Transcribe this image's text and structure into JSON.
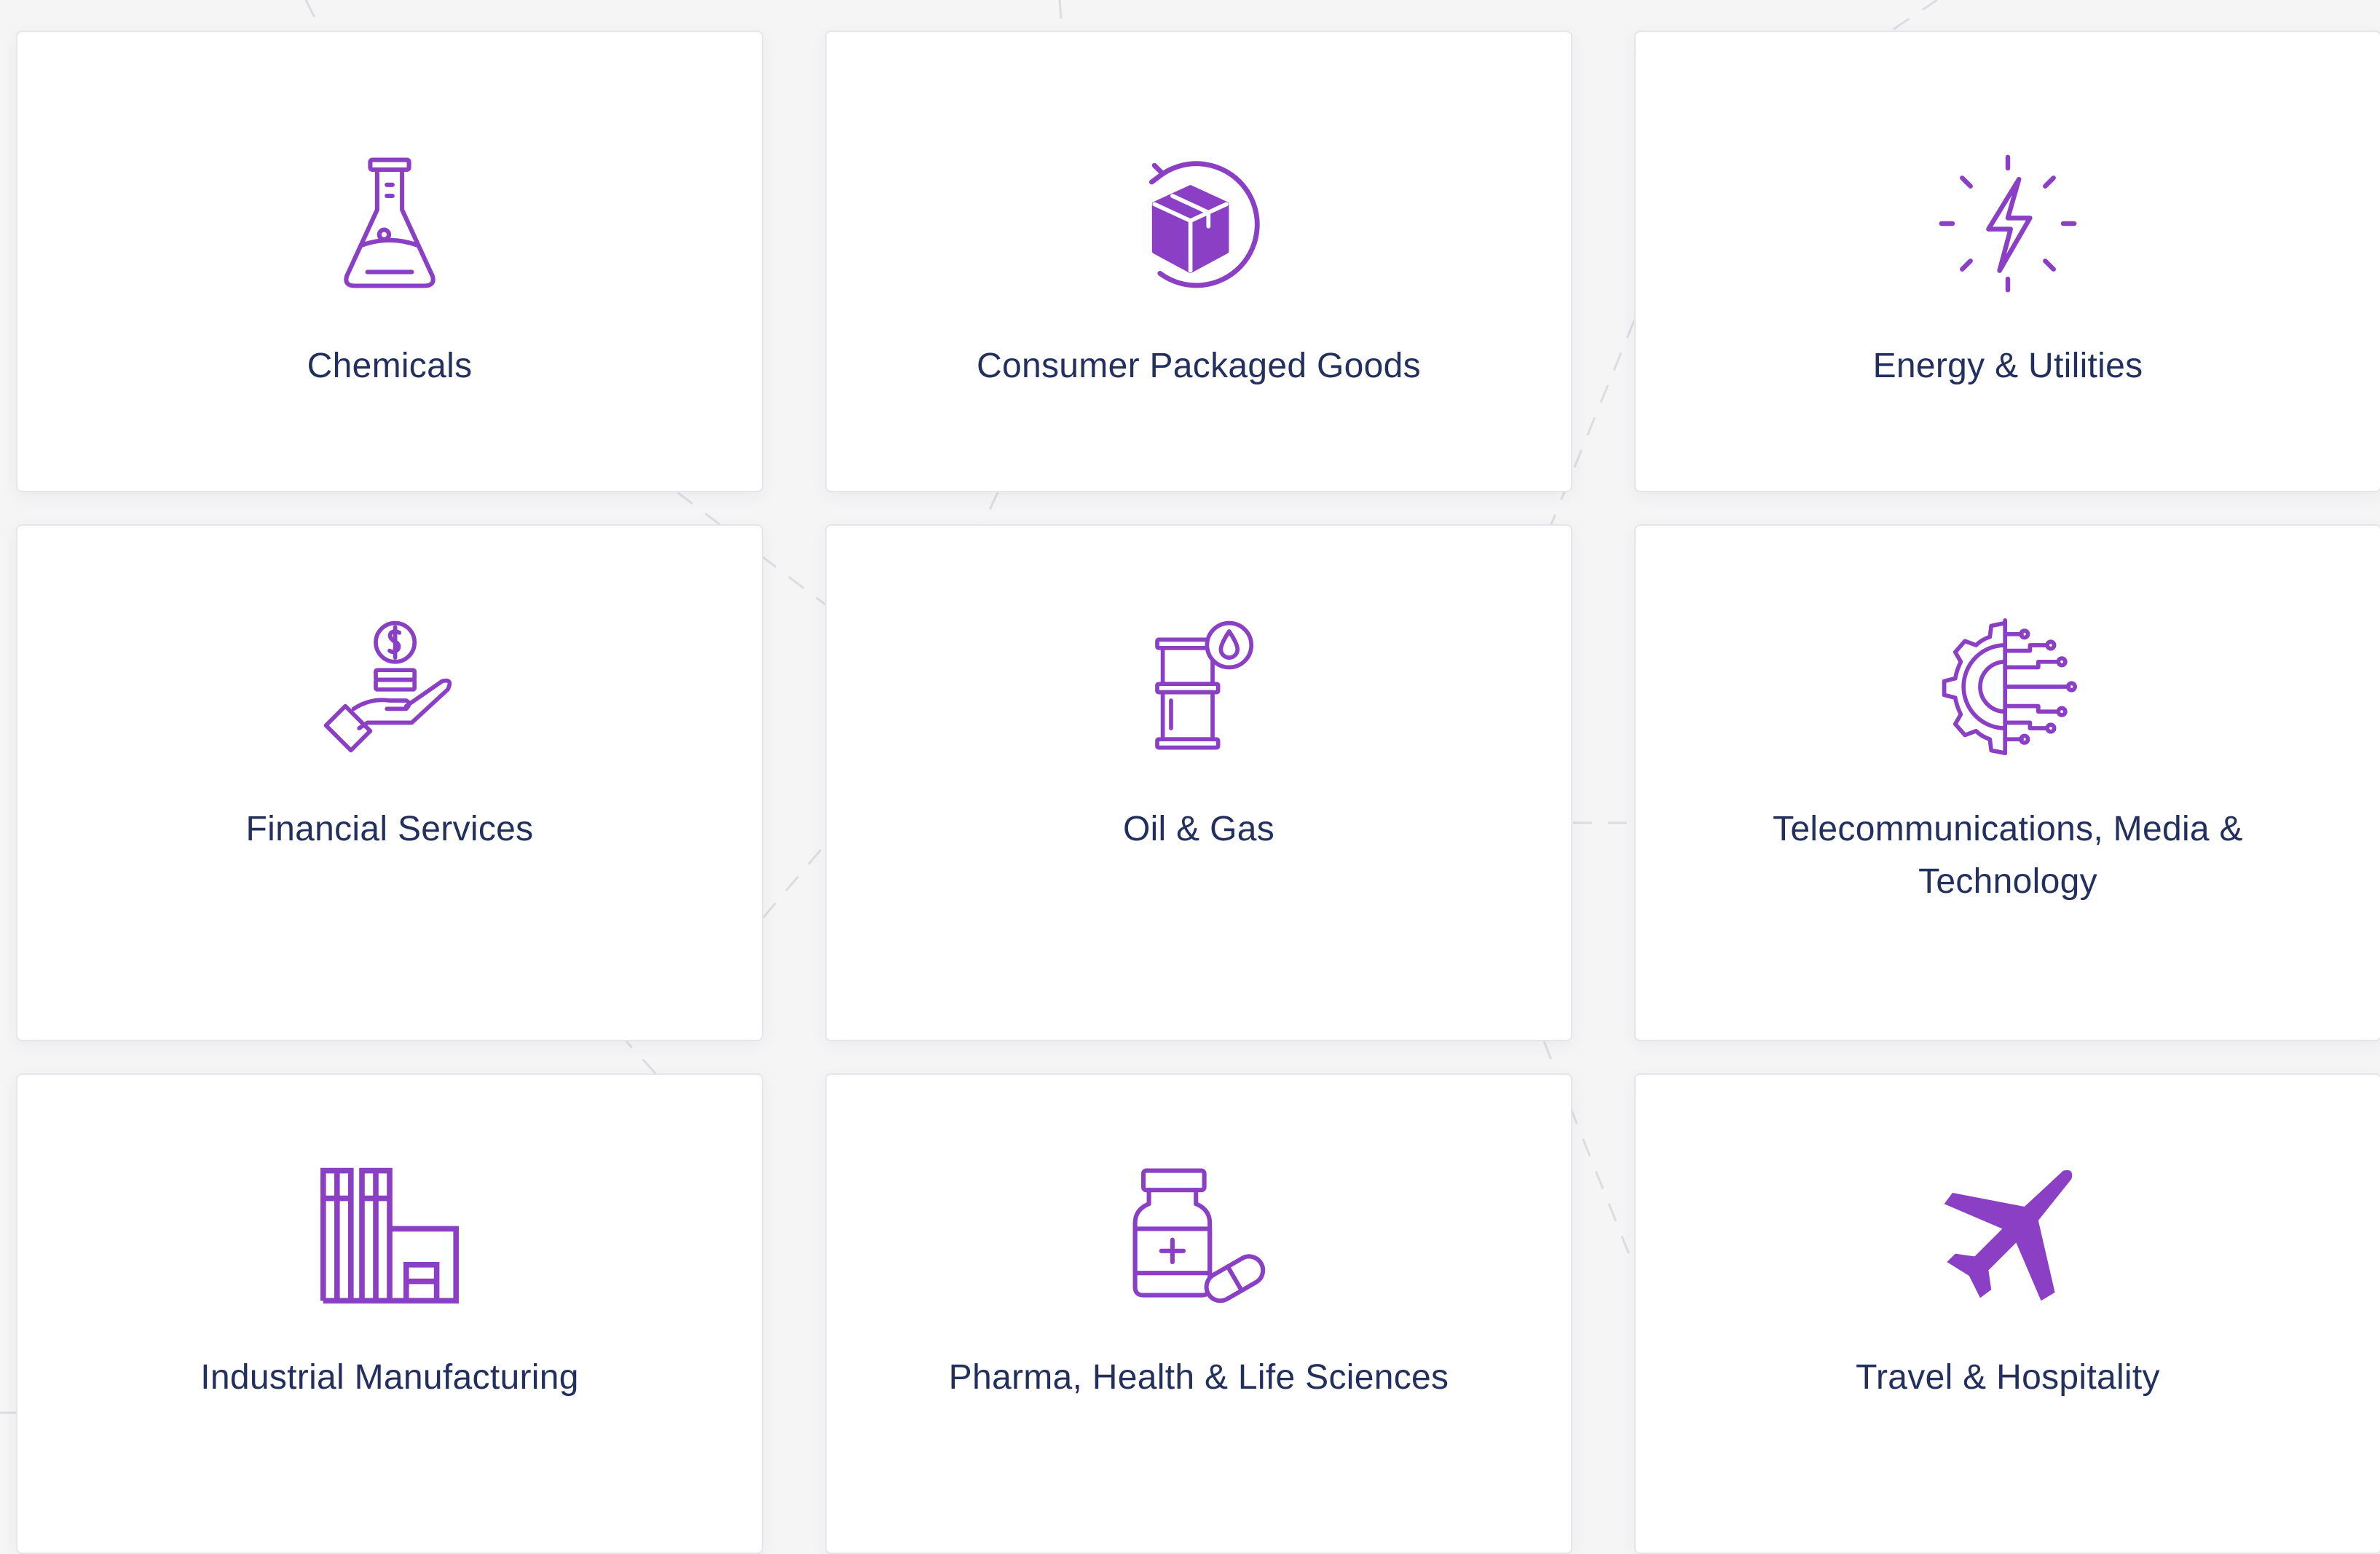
{
  "colors": {
    "accent": "#8b3fc4",
    "label_text": "#23305e",
    "card_bg": "#ffffff",
    "page_bg": "#f5f5f6"
  },
  "industries": [
    {
      "label": "Chemicals",
      "icon": "flask-icon"
    },
    {
      "label": "Consumer Packaged Goods",
      "icon": "package-cycle-icon"
    },
    {
      "label": "Energy & Utilities",
      "icon": "lightning-icon"
    },
    {
      "label": "Financial Services",
      "icon": "hand-coin-icon"
    },
    {
      "label": "Oil & Gas",
      "icon": "oil-barrel-icon"
    },
    {
      "label": "Telecommunications, Media & Technology",
      "icon": "gear-circuit-icon"
    },
    {
      "label": "Industrial Manufacturing",
      "icon": "factory-icon"
    },
    {
      "label": "Pharma, Health & Life Sciences",
      "icon": "medicine-bottle-icon"
    },
    {
      "label": "Travel & Hospitality",
      "icon": "airplane-icon"
    }
  ]
}
